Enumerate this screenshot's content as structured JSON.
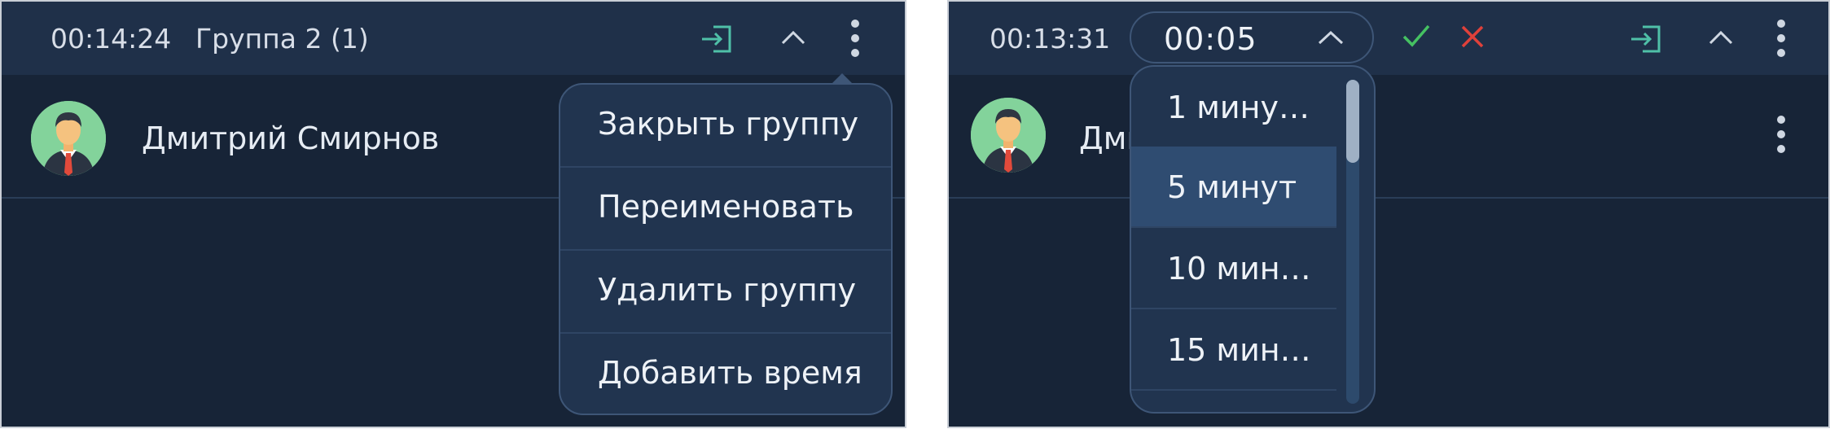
{
  "left": {
    "timer": "00:14:24",
    "group_title": "Группа 2 (1)",
    "member_name": "Дмитрий Смирнов",
    "menu_items": [
      "Закрыть группу",
      "Переименовать",
      "Удалить группу",
      "Добавить время"
    ],
    "icons": [
      "enter-icon",
      "chevron-up-icon",
      "more-vertical-icon"
    ]
  },
  "right": {
    "timer": "00:13:31",
    "time_value": "00:05",
    "member_name_visible": "Дми",
    "dropdown_options": [
      {
        "label": "1 мину…",
        "selected": false
      },
      {
        "label": "5 минут",
        "selected": true
      },
      {
        "label": "10 мин…",
        "selected": false
      },
      {
        "label": "15 мин…",
        "selected": false
      }
    ],
    "icons": [
      "check-icon",
      "close-icon",
      "enter-icon",
      "chevron-up-icon",
      "more-vertical-icon"
    ]
  },
  "colors": {
    "background": "#172437",
    "header": "#1f3049",
    "accent_teal": "#4fc0a8",
    "confirm_green": "#45c162",
    "cancel_red": "#e0413a",
    "selected_row": "#2f4c71"
  }
}
